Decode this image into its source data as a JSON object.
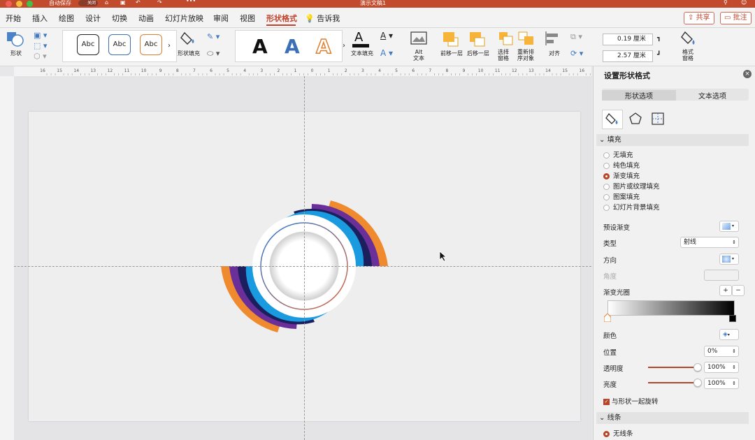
{
  "titlebar": {
    "autosave_label": "自动保存",
    "toggle_label": "关闭",
    "doc_title": "演示文稿1"
  },
  "menubar": {
    "items": [
      "开始",
      "插入",
      "绘图",
      "设计",
      "切换",
      "动画",
      "幻灯片放映",
      "审阅",
      "视图",
      "形状格式"
    ],
    "tell_me": "告诉我",
    "share": "共享",
    "comments": "批注"
  },
  "ribbon": {
    "shape_label": "形状",
    "abc_text": "Abc",
    "shape_fill_label": "形状填充",
    "wordart_letter": "A",
    "text_fill_label": "文本填充",
    "alt_text_label": "Alt\n文本",
    "bring_forward_label": "前移一层",
    "send_backward_label": "后移一层",
    "selection_pane_label": "选择\n窗格",
    "reorder_label": "重新排\n序对象",
    "align_label": "对齐",
    "height_value": "0.19 厘米",
    "width_value": "2.57 厘米",
    "format_pane_label": "格式\n窗格"
  },
  "ruler": {
    "marks": [
      "16",
      "15",
      "14",
      "13",
      "12",
      "11",
      "10",
      "9",
      "8",
      "7",
      "6",
      "5",
      "4",
      "3",
      "2",
      "1",
      "0",
      "1",
      "2",
      "3",
      "4",
      "5",
      "6",
      "7",
      "8",
      "9",
      "10",
      "11",
      "12",
      "13",
      "14",
      "15",
      "16"
    ]
  },
  "pane": {
    "title": "设置形状格式",
    "tabs": [
      "形状选项",
      "文本选项"
    ],
    "fill_section": "填充",
    "fill_options": [
      "无填充",
      "纯色填充",
      "渐变填充",
      "图片或纹理填充",
      "图案填充",
      "幻灯片背景填充"
    ],
    "fill_selected": "渐变填充",
    "preset_label": "预设渐变",
    "type_label": "类型",
    "type_value": "射线",
    "direction_label": "方向",
    "angle_label": "角度",
    "stops_label": "渐变光圈",
    "add_stop": "+",
    "remove_stop": "−",
    "color_label": "颜色",
    "position_label": "位置",
    "position_value": "0%",
    "transparency_label": "透明度",
    "transparency_value": "100%",
    "brightness_label": "亮度",
    "brightness_value": "100%",
    "rotate_label": "与形状一起旋转",
    "line_section": "线条",
    "no_line_label": "无线条"
  },
  "colors": {
    "accent": "#c0442c",
    "orange": "#ef8a2e",
    "purple": "#6a2f99",
    "navy": "#1b1f5e",
    "blue": "#1a9be0"
  }
}
